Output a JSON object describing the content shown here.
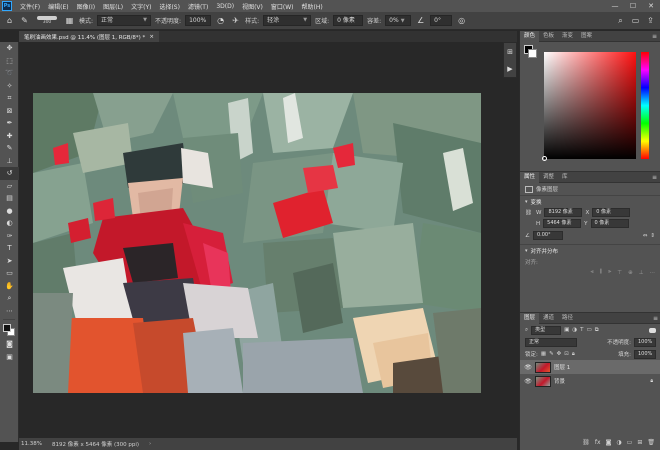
{
  "app": {
    "logo": "Ps"
  },
  "menu": [
    "文件(F)",
    "编辑(E)",
    "图像(I)",
    "图层(L)",
    "文字(Y)",
    "选择(S)",
    "滤镜(T)",
    "3D(D)",
    "视图(V)",
    "窗口(W)",
    "帮助(H)"
  ],
  "window_controls": [
    "—",
    "☐",
    "✕"
  ],
  "options": {
    "brush_size": "300",
    "mode_label": "模式:",
    "mode_value": "正常",
    "opacity_label": "不透明度:",
    "opacity_value": "100%",
    "style_label": "样式:",
    "style_value": "轻涂",
    "area_label": "区域:",
    "area_value": "0 像素",
    "tolerance_label": "容差:",
    "tolerance_value": "0%",
    "angle_value": "0°"
  },
  "document": {
    "tab_title": "笔刷油画效果.psd @ 11.4% (图层 1, RGB/8*) *",
    "close": "×"
  },
  "status": {
    "zoom": "11.38%",
    "dimensions": "8192 像素 x 5464 像素 (300 ppi)"
  },
  "color_panel": {
    "tabs": [
      "颜色",
      "色板",
      "渐变",
      "图案"
    ]
  },
  "properties_panel": {
    "tabs": [
      "属性",
      "调整",
      "库"
    ],
    "layer_type": "像素图层",
    "transform_label": "变换",
    "w_label": "W",
    "w_value": "8192 像素",
    "h_label": "H",
    "h_value": "5464 像素",
    "x_label": "X",
    "x_value": "0 像素",
    "y_label": "Y",
    "y_value": "0 像素",
    "angle_value": "0.00°",
    "align_label": "对齐并分布",
    "align_sub": "对齐:"
  },
  "layers_panel": {
    "tabs": [
      "图层",
      "通道",
      "路径"
    ],
    "filter_label": "类型",
    "blend_mode": "正常",
    "opacity_label": "不透明度:",
    "opacity_value": "100%",
    "lock_label": "锁定:",
    "fill_label": "填充:",
    "fill_value": "100%",
    "layers": [
      {
        "name": "图层 1",
        "selected": true
      },
      {
        "name": "背景",
        "selected": false,
        "locked": true
      }
    ]
  },
  "colors": {
    "accent": "#31a8ff",
    "panel_bg": "#535353",
    "menubar_bg": "#535353",
    "optbar_bg": "#424242",
    "canvas_bg": "#282828"
  }
}
